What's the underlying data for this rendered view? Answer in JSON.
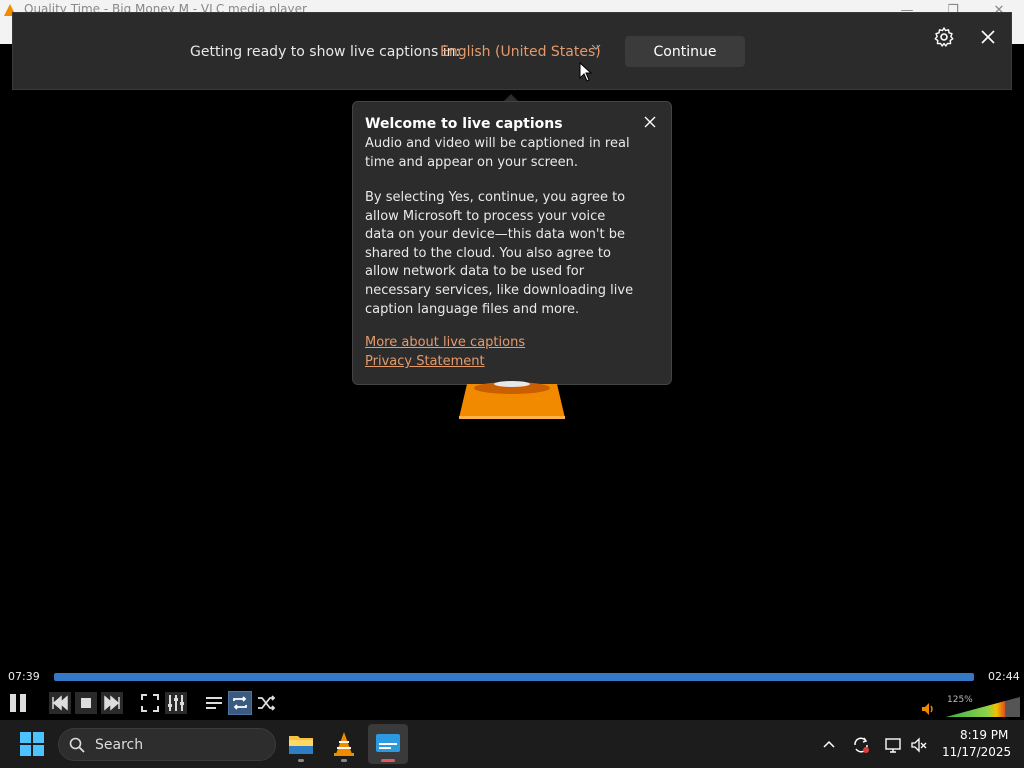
{
  "window": {
    "title": "Quality Time - Big Money M - VLC media player",
    "minimize": "—",
    "restore": "❐",
    "close": "✕"
  },
  "live_captions": {
    "prompt": "Getting ready to show live captions in:",
    "language": "English (United States)",
    "continue_label": "Continue"
  },
  "welcome": {
    "title": "Welcome to live captions",
    "paragraph1": "Audio and video will be captioned in real time and appear on your screen.",
    "paragraph2": "By selecting Yes, continue, you agree to allow Microsoft to process your voice data on your device—this data won't be shared to the cloud. You also agree to allow network data to be used for necessary services, like downloading live caption language files and more.",
    "link_more": "More about live captions",
    "link_privacy": "Privacy Statement"
  },
  "player": {
    "elapsed": "07:39",
    "remaining": "02:44",
    "progress_fraction": 1.0,
    "volume_label": "125%",
    "volume_fraction": 0.8
  },
  "taskbar": {
    "search_placeholder": "Search",
    "clock_time": "8:19 PM",
    "clock_date": "11/17/2025"
  },
  "colors": {
    "accent_link": "#e59a6b",
    "seek": "#3478c6",
    "vlc_orange": "#f28a00"
  }
}
